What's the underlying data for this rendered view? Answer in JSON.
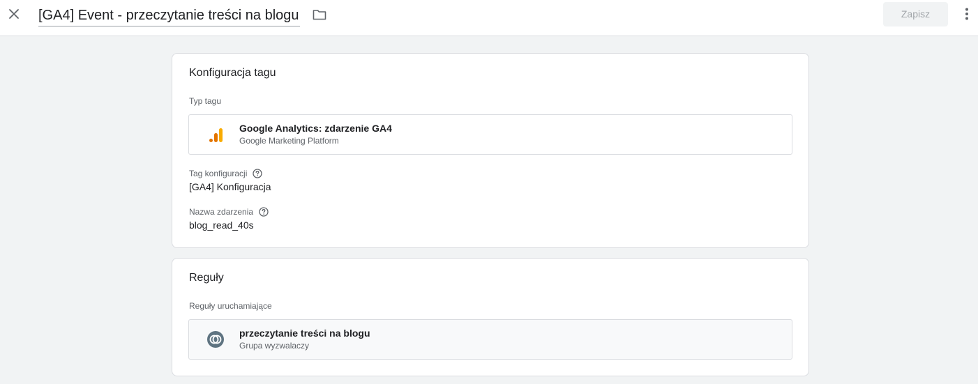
{
  "header": {
    "title": "[GA4] Event - przeczytanie treści na blogu",
    "save_label": "Zapisz",
    "close_icon": "close-icon",
    "folder_icon": "folder-icon",
    "more_icon": "more-vert-icon"
  },
  "tag_config": {
    "title": "Konfiguracja tagu",
    "type_label": "Typ tagu",
    "type": {
      "name": "Google Analytics: zdarzenie GA4",
      "platform": "Google Marketing Platform",
      "icon": "google-analytics-icon"
    },
    "config_tag_label": "Tag konfiguracji",
    "config_tag_value": "[GA4] Konfiguracja",
    "event_name_label": "Nazwa zdarzenia",
    "event_name_value": "blog_read_40s"
  },
  "triggering": {
    "title": "Reguły",
    "label": "Reguły uruchamiające",
    "trigger": {
      "name": "przeczytanie treści na blogu",
      "type": "Grupa wyzwalaczy",
      "icon": "trigger-group-icon"
    }
  },
  "colors": {
    "accent_orange": "#f9ab00",
    "accent_orange_dark": "#e37400",
    "trigger_icon": "#5f7481",
    "background": "#f1f3f4"
  }
}
